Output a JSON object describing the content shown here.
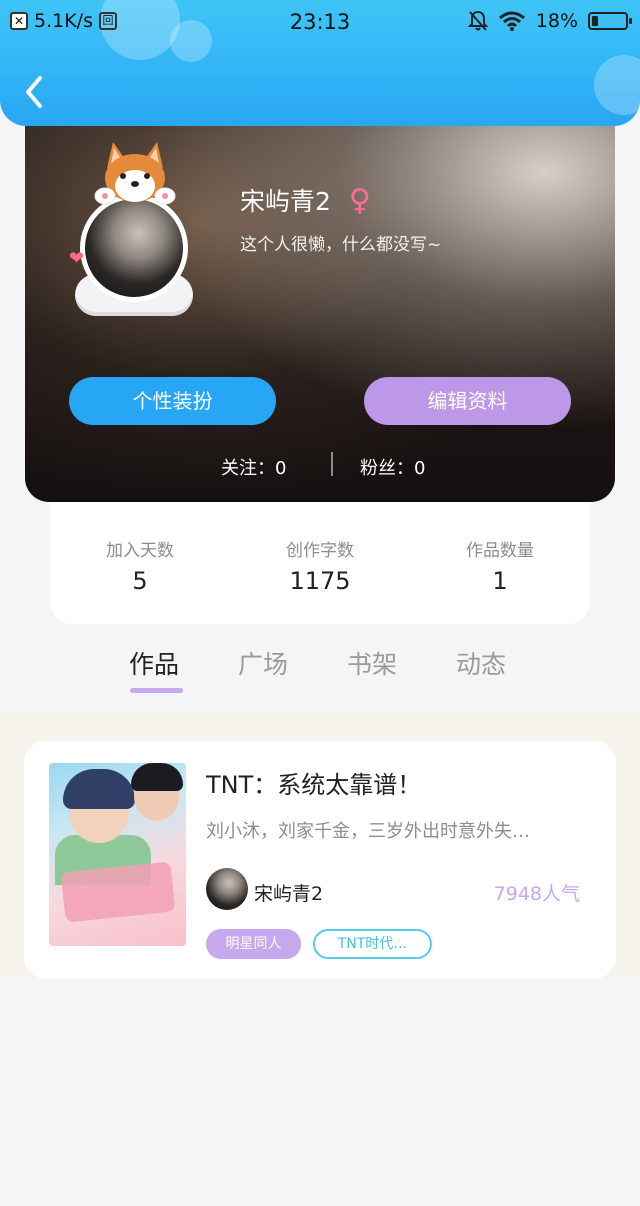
{
  "status_bar": {
    "net_speed": "5.1K/s",
    "time": "23:13",
    "battery_pct": "18%",
    "battery_level": 0.18
  },
  "profile": {
    "username": "宋屿青2",
    "gender_symbol": "♀",
    "bio": "这个人很懒，什么都没写~",
    "btn_dress": "个性装扮",
    "btn_edit": "编辑资料",
    "following_label": "关注：0",
    "followers_label": "粉丝：0"
  },
  "stats": [
    {
      "label": "加入天数",
      "value": "5"
    },
    {
      "label": "创作字数",
      "value": "1175"
    },
    {
      "label": "作品数量",
      "value": "1"
    }
  ],
  "tabs": [
    {
      "label": "作品",
      "active": true
    },
    {
      "label": "广场",
      "active": false
    },
    {
      "label": "书架",
      "active": false
    },
    {
      "label": "动态",
      "active": false
    }
  ],
  "books": [
    {
      "title": "TNT：系统太靠谱！",
      "description": "刘小沐，刘家千金，三岁外出时意外失…",
      "author": "宋屿青2",
      "popularity": "7948人气",
      "tags": [
        "明星同人",
        "TNT时代…"
      ]
    }
  ],
  "colors": {
    "header": "#2fb0f5",
    "accent_purple": "#bd97e8",
    "accent_blue": "#27a6f5"
  }
}
